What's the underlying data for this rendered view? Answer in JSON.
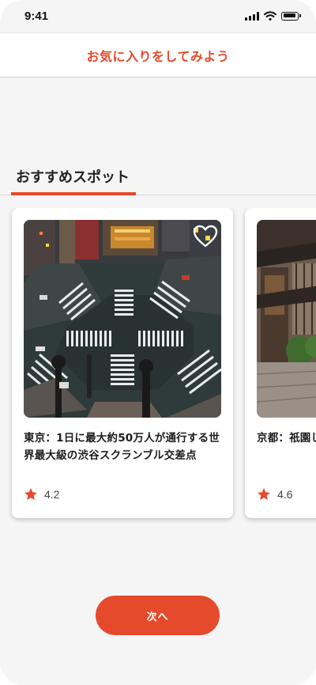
{
  "status_bar": {
    "time": "9:41"
  },
  "header": {
    "title": "お気に入りをしてみよう"
  },
  "section": {
    "tab_label": "おすすめスポット"
  },
  "spots": [
    {
      "title": "東京：1日に最大約50万人が通行する世界最大級の渋谷スクランブル交差点",
      "rating": "4.2",
      "favorite": false
    },
    {
      "title": "京都：祇園しむなら『",
      "rating": "4.6",
      "favorite": false
    }
  ],
  "next_button": {
    "label": "次へ"
  },
  "colors": {
    "accent": "#e54a2c",
    "background": "#f5f5f5",
    "card": "#ffffff"
  }
}
